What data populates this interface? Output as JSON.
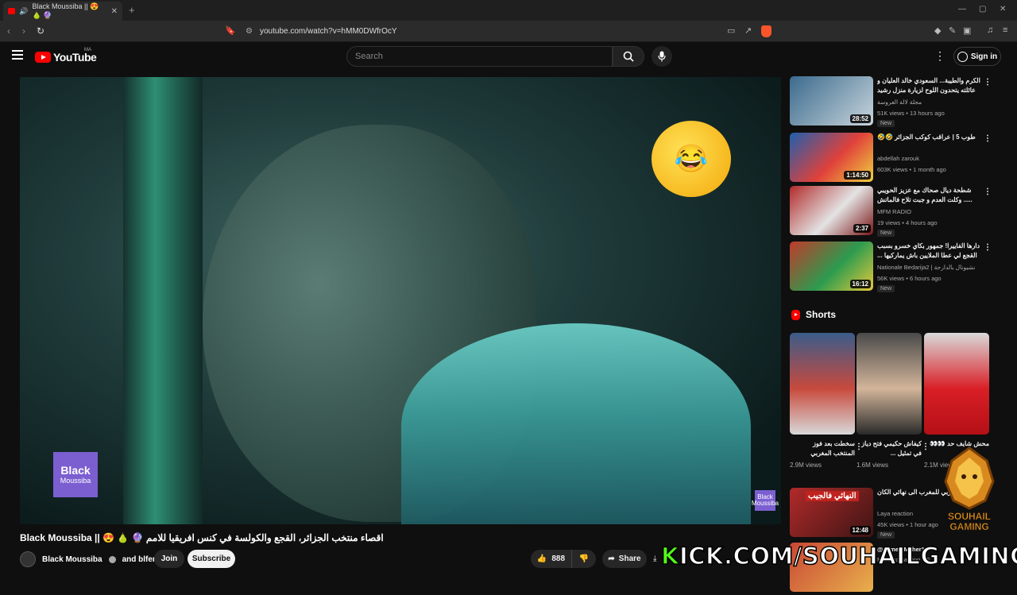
{
  "browser": {
    "tab_title": "Black Moussiba || 😍 🍐 🔮",
    "new_tab": "+",
    "url": "youtube.com/watch?v=hMM0DWfrOcY"
  },
  "header": {
    "logo_text": "YouTube",
    "country_code": "MA",
    "search_placeholder": "Search",
    "signin_label": "Sign in"
  },
  "video": {
    "channel_tile_line1": "Black",
    "channel_tile_line2": "Moussiba",
    "watermark": "Black Moussiba",
    "title": "Black Moussiba || 😍 🍐 🔮 اقصاء منتخب الجزائر، القجع والكولسة في كنس افريقيا للامم",
    "channel_name": "Black Moussiba",
    "collab": "and blfen",
    "join_label": "Join",
    "subscribe_label": "Subscribe",
    "like_count": "888",
    "share_label": "Share",
    "download_label": "D"
  },
  "recommendations": [
    {
      "title": "الكرم والطيبة... السعودي خالد العليان و عائلته يتحدون اللوح لزيارة منزل رشيد المغربي |",
      "channel": "مجلة لالة العروسة",
      "meta": "51K views • 13 hours ago",
      "duration": "28:52",
      "badge": "New",
      "colors": [
        "#3c6a8e",
        "#88a5b8",
        "#c9d5de"
      ]
    },
    {
      "title": "طوب 5 | عراقب كوكب الجزائر 🤣🤣",
      "channel": "abdellah zarouk",
      "meta": "603K views • 1 month ago",
      "duration": "1:14:50",
      "badge": "",
      "colors": [
        "#1f5fae",
        "#e0413a",
        "#f0d241"
      ]
    },
    {
      "title": "شطحة ديال صحاك مع عزيز الحويبي ..... وكلت العدم و جبت تلاح فالماتش",
      "channel": "MFM RADIO",
      "meta": "19 views • 4 hours ago",
      "duration": "2:37",
      "badge": "New",
      "colors": [
        "#b22a2a",
        "#e3e3e3",
        "#7a1515"
      ]
    },
    {
      "title": "دارها الفاييرا! جمهور بكاي خسرو بسبب القجع لي عطا الملايين باش يماركيها ...",
      "channel": "Nationale Bedarija2 | نشيونال بالدارجة",
      "meta": "56K views • 6 hours ago",
      "duration": "16:12",
      "badge": "New",
      "colors": [
        "#c23a2a",
        "#2c9b4f",
        "#e5c93b"
      ]
    }
  ],
  "shorts": {
    "heading": "Shorts",
    "items": [
      {
        "title": "سخطت بعد فوز المنتخب المغربي",
        "views": "2.9M views",
        "colors": [
          "#3b5c8a",
          "#c84a3d",
          "#d9d9d9"
        ]
      },
      {
        "title": "كيفاش حكيمي فتح دياز في تمثيل ...",
        "views": "1.6M views",
        "colors": [
          "#4a4a4a",
          "#d3b59a",
          "#2a2a2a"
        ]
      },
      {
        "title": "محش شايف حد 👀👀",
        "views": "2.1M views",
        "colors": [
          "#d9d9d9",
          "#d91f26",
          "#b41016"
        ]
      }
    ]
  },
  "rec5": {
    "title": "مغربي للمغرب الى نهائي الكان",
    "channel": "Laya reaction",
    "meta": "45K views • 1 hour ago",
    "duration": "12:48",
    "badge": "New",
    "thumb_text": "النهائي فالجيب"
  },
  "rec6": {
    "channel": "@ahmed Maher10",
    "meta": "Marerco gaming GF"
  },
  "overlay": {
    "kick_text": "KICK.COM/SOUHAILGAMING",
    "brand_line1": "SOUHAIL",
    "brand_line2": "GAMING"
  }
}
